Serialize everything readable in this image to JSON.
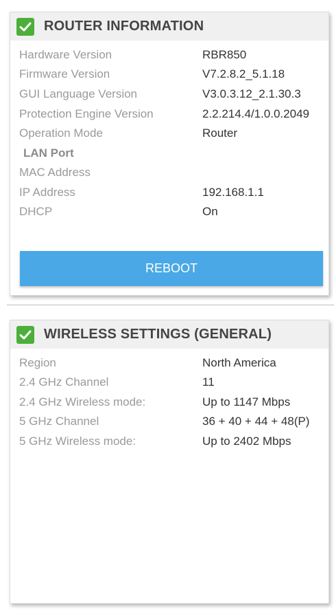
{
  "router": {
    "title": "ROUTER INFORMATION",
    "rows": [
      {
        "label": "Hardware Version",
        "value": "RBR850"
      },
      {
        "label": "Firmware Version",
        "value": "V7.2.8.2_5.1.18"
      },
      {
        "label": "GUI Language Version",
        "value": "V3.0.3.12_2.1.30.3"
      },
      {
        "label": "Protection Engine Version",
        "value": "2.2.214.4/1.0.0.2049"
      },
      {
        "label": "Operation Mode",
        "value": "Router"
      }
    ],
    "lan_heading": "LAN Port",
    "lan_rows": [
      {
        "label": "MAC Address",
        "value": ""
      },
      {
        "label": "IP Address",
        "value": "192.168.1.1"
      },
      {
        "label": "DHCP",
        "value": "On"
      }
    ],
    "reboot_label": "REBOOT"
  },
  "wireless": {
    "title": "WIRELESS SETTINGS (GENERAL)",
    "rows": [
      {
        "label": "Region",
        "value": "North America"
      },
      {
        "label": "2.4 GHz Channel",
        "value": "11"
      },
      {
        "label": "2.4 GHz Wireless mode:",
        "value": "Up to 1147 Mbps"
      },
      {
        "label": "5 GHz Channel",
        "value": "36 + 40 + 44 + 48(P)"
      },
      {
        "label": "5 GHz Wireless mode:",
        "value": "Up to 2402 Mbps"
      }
    ]
  },
  "colors": {
    "check_green": "#4caf3a",
    "button_blue": "#4aa8e6",
    "label_gray": "#9a9a9a",
    "header_bg": "#f0f0f0"
  },
  "icons": {
    "header_check": "checkmark-icon"
  }
}
